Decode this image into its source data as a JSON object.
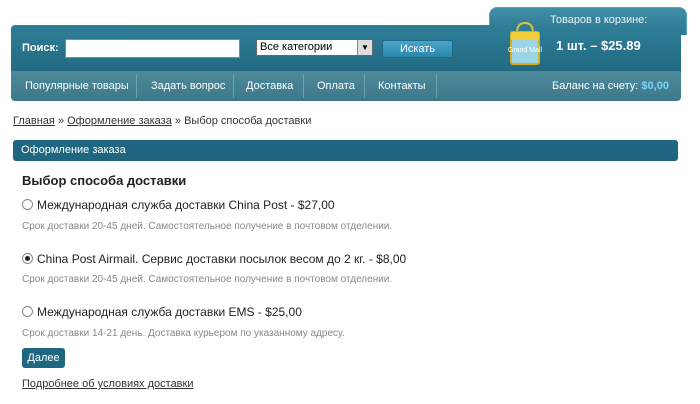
{
  "header": {
    "search_label": "Поиск:",
    "search_value": "",
    "category_selected": "Все категории",
    "search_button": "Искать",
    "cart_title": "Товаров в корзине:",
    "cart_logo_text": "Grand Mall",
    "cart_summary": "1 шт.  –  $25.89",
    "balance_label": "Баланс на счету:",
    "balance_value": "$0,00"
  },
  "nav": {
    "items": [
      "Популярные товары",
      "Задать вопрос",
      "Доставка",
      "Оплата",
      "Контакты"
    ]
  },
  "breadcrumb": {
    "home": "Главная",
    "sep": "»",
    "order": "Оформление заказа",
    "current": "Выбор способа доставки"
  },
  "section_title": "Оформление заказа",
  "page_title": "Выбор способа доставки",
  "options": [
    {
      "label": "Международная служба доставки China Post - $27,00",
      "note": "Срок доставки 20-45 дней. Самостоятельное получение в почтовом отделении.",
      "selected": false
    },
    {
      "label": "China Post Airmail. Сервис доставки посылок весом до 2 кг. - $8,00",
      "note": "Срок доставки 20-45 дней. Самостоятельное получение в почтовом отделении.",
      "selected": true
    },
    {
      "label": "Международная служба доставки EMS - $25,00",
      "note": "Срок доставки 14-21 день. Доставка курьером по указанному адресу.",
      "selected": false
    }
  ],
  "next_button": "Далее",
  "more_link": "Подробнее об условиях доставки",
  "colors": {
    "header": "#226a82",
    "nav": "#3c7889",
    "accent": "#1f6680",
    "balance": "#7fd4f4"
  }
}
